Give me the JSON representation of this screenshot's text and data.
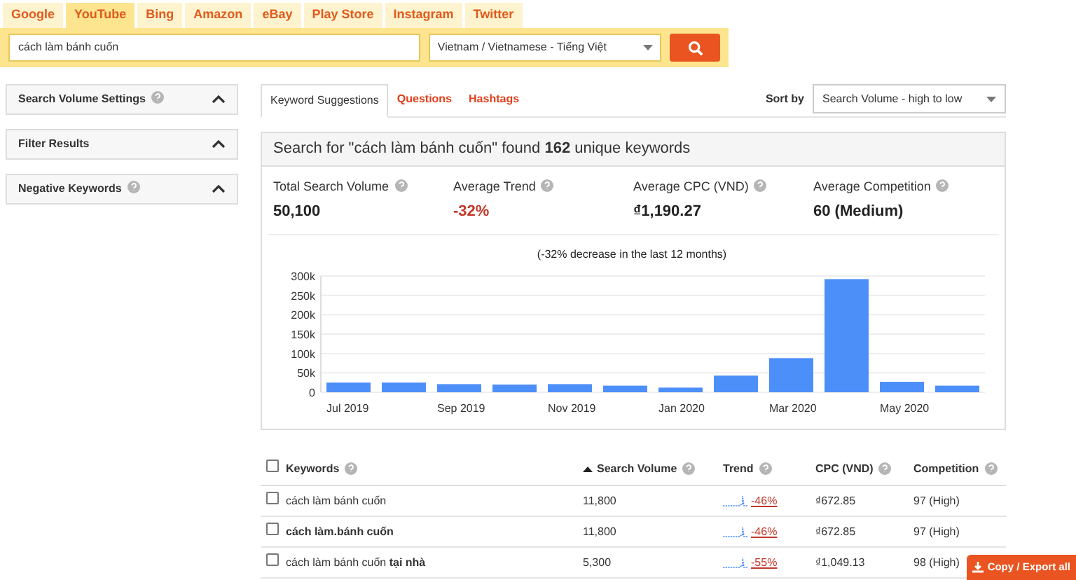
{
  "platform_tabs": [
    {
      "label": "Google",
      "selected": false
    },
    {
      "label": "YouTube",
      "selected": true
    },
    {
      "label": "Bing",
      "selected": false
    },
    {
      "label": "Amazon",
      "selected": false
    },
    {
      "label": "eBay",
      "selected": false
    },
    {
      "label": "Play Store",
      "selected": false
    },
    {
      "label": "Instagram",
      "selected": false
    },
    {
      "label": "Twitter",
      "selected": false
    }
  ],
  "search": {
    "value": "cách làm bánh cuốn",
    "language": "Vietnam / Vietnamese - Tiếng Việt"
  },
  "sidebar": {
    "panels": [
      {
        "title": "Search Volume Settings",
        "help": true,
        "expanded": true
      },
      {
        "title": "Filter Results",
        "help": false,
        "expanded": true
      },
      {
        "title": "Negative Keywords",
        "help": true,
        "expanded": true
      }
    ]
  },
  "result_tabs": [
    {
      "label": "Keyword Suggestions",
      "selected": true
    },
    {
      "label": "Questions",
      "selected": false
    },
    {
      "label": "Hashtags",
      "selected": false
    }
  ],
  "sort": {
    "label": "Sort by",
    "value": "Search Volume - high to low"
  },
  "summary": {
    "heading": "Search for \"cách làm bánh cuốn\" found **162** unique keywords",
    "stats": [
      {
        "label": "Total Search Volume",
        "value": "50,100",
        "negative": false
      },
      {
        "label": "Average Trend",
        "value": "-32%",
        "negative": true
      },
      {
        "label": "Average CPC (VND)",
        "value": "₫1,190.27",
        "negative": false
      },
      {
        "label": "Average Competition",
        "value": "60 (Medium)",
        "negative": false
      }
    ],
    "chart_data": {
      "type": "bar",
      "title": "(-32% decrease in the last 12 months)",
      "grid": true,
      "categories": [
        "Jul 2019",
        null,
        "Sep 2019",
        null,
        "Nov 2019",
        null,
        "Jan 2020",
        null,
        "Mar 2020",
        null,
        "May 2020",
        null
      ],
      "values": [
        25000,
        25000,
        21000,
        20000,
        21000,
        17000,
        12000,
        43000,
        88000,
        292000,
        27000,
        17000
      ],
      "ylim": [
        0,
        300000
      ],
      "yticks": [
        {
          "value": 0,
          "label": "0"
        },
        {
          "value": 50000,
          "label": "50k"
        },
        {
          "value": 100000,
          "label": "100k"
        },
        {
          "value": 150000,
          "label": "150k"
        },
        {
          "value": 200000,
          "label": "200k"
        },
        {
          "value": 250000,
          "label": "250k"
        },
        {
          "value": 300000,
          "label": "300k"
        }
      ]
    }
  },
  "table": {
    "select_all_checked": false,
    "columns": [
      {
        "label": "Keywords",
        "sorted": false
      },
      {
        "label": "Search Volume",
        "sorted": true
      },
      {
        "label": "Trend",
        "sorted": false
      },
      {
        "label": "CPC (VND)",
        "sorted": false
      },
      {
        "label": "Competition",
        "sorted": false
      }
    ],
    "rows": [
      {
        "checked": false,
        "bold": false,
        "keyword": "cách làm bánh cuốn",
        "volume": "11,800",
        "trend": "-46%",
        "cpc": "₫672.85",
        "competition": "97 (High)"
      },
      {
        "checked": false,
        "bold": true,
        "keyword": "cách làm.bánh cuốn",
        "volume": "11,800",
        "trend": "-46%",
        "cpc": "₫672.85",
        "competition": "97 (High)"
      },
      {
        "checked": false,
        "bold": false,
        "keyword": "cách làm bánh cuốn **tại nhà**",
        "volume": "5,300",
        "trend": "-55%",
        "cpc": "₫1,049.13",
        "competition": "98 (High)"
      }
    ]
  },
  "export_button": "Copy / Export all"
}
